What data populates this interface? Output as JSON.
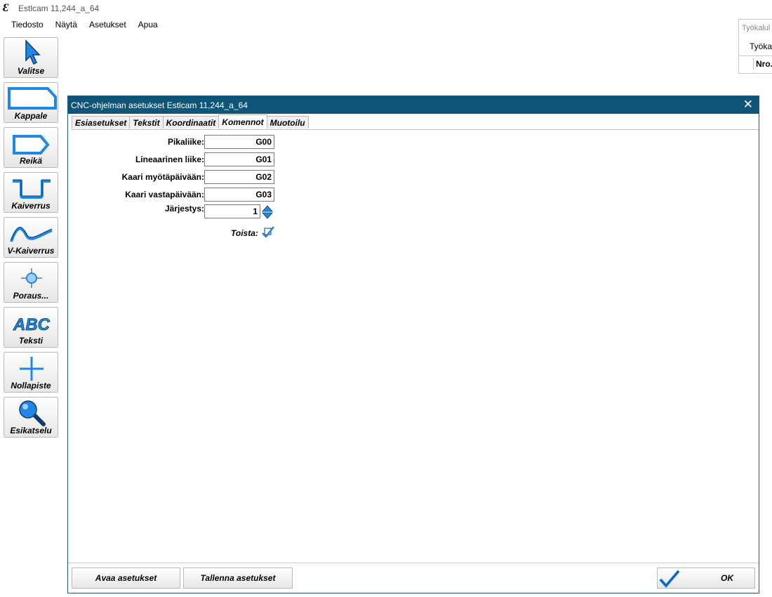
{
  "window": {
    "title": "Estlcam 11,244_a_64"
  },
  "menu": [
    "Tiedosto",
    "Näytä",
    "Asetukset",
    "Apua"
  ],
  "toolbar": [
    {
      "label": "Valitse",
      "icon": "pointer-icon"
    },
    {
      "label": "Kappale",
      "icon": "part-icon"
    },
    {
      "label": "Reikä",
      "icon": "hole-icon"
    },
    {
      "label": "Kaiverrus",
      "icon": "engrave-icon"
    },
    {
      "label": "V-Kaiverrus",
      "icon": "v-engrave-icon"
    },
    {
      "label": "Poraus...",
      "icon": "drill-icon"
    },
    {
      "label": "Teksti",
      "icon": "text-icon"
    },
    {
      "label": "Nollapiste",
      "icon": "origin-icon"
    },
    {
      "label": "Esikatselu",
      "icon": "magnifier-icon"
    }
  ],
  "tool_panel": {
    "title": "Työkalul",
    "tab": "Työkal",
    "column": "Nro."
  },
  "dialog": {
    "title": "CNC-ohjelman asetukset Estlcam 11,244_a_64",
    "close": "✕",
    "tabs": [
      "Esiasetukset",
      "Tekstit",
      "Koordinaatit",
      "Komennot",
      "Muotoilu"
    ],
    "active_tab": "Komennot",
    "fields": [
      {
        "label": "Pikaliike:",
        "value": "G00"
      },
      {
        "label": "Lineaarinen liike:",
        "value": "G01"
      },
      {
        "label": "Kaari myötäpäivään:",
        "value": "G02"
      },
      {
        "label": "Kaari vastapäivään:",
        "value": "G03"
      }
    ],
    "order": {
      "label": "Järjestys:",
      "value": "1"
    },
    "repeat": {
      "label": "Toista:",
      "checked": true
    },
    "buttons": {
      "open": "Avaa asetukset",
      "save": "Tallenna asetukset",
      "ok": "OK"
    }
  },
  "colors": {
    "accent": "#0e5578",
    "icon_blue": "#1f87e6"
  }
}
